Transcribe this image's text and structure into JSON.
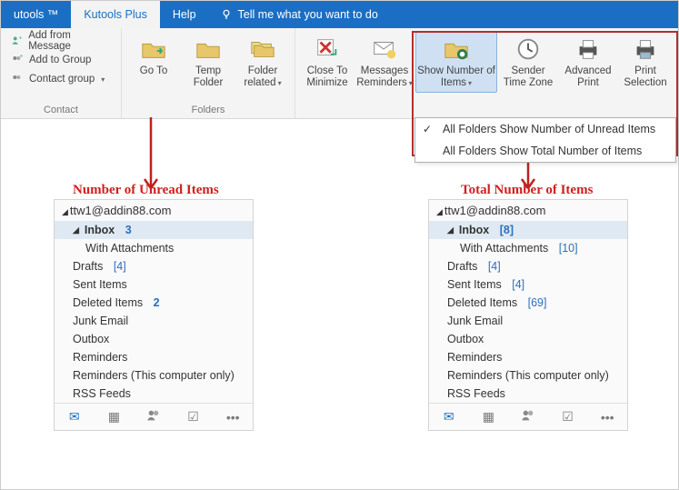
{
  "tabs": {
    "utools": "utools ™",
    "kutools_plus": "Kutools Plus",
    "help": "Help",
    "tellme": "Tell me what you want to do"
  },
  "ribbon": {
    "contact": {
      "label": "Contact",
      "add_from_message": "Add from Message",
      "add_to_group": "Add to Group",
      "contact_group": "Contact group"
    },
    "folders": {
      "label": "Folders",
      "goto": "Go To",
      "temp_folder": "Temp Folder",
      "folder_related": "Folder related"
    },
    "view": {
      "close_to_minimize": "Close To Minimize",
      "messages_reminders": "Messages Reminders",
      "show_number": "Show Number of Items",
      "sender_tz": "Sender Time Zone",
      "adv_print": "Advanced Print",
      "print_sel": "Print Selection"
    }
  },
  "dropdown": {
    "opt1": "All Folders Show Number of Unread Items",
    "opt2": "All Folders Show Total Number of Items"
  },
  "labels": {
    "unread": "Number of Unread Items",
    "total": "Total Number of Items"
  },
  "account": "ttw1@addin88.com",
  "panel_left": {
    "inbox": {
      "name": "Inbox",
      "count": "3"
    },
    "with_attach": {
      "name": "With Attachments",
      "count": ""
    },
    "drafts": {
      "name": "Drafts",
      "count": "[4]"
    },
    "sent": {
      "name": "Sent Items",
      "count": ""
    },
    "deleted": {
      "name": "Deleted Items",
      "count": "2"
    },
    "junk": {
      "name": "Junk Email"
    },
    "outbox": {
      "name": "Outbox"
    },
    "reminders": {
      "name": "Reminders"
    },
    "reminders_local": {
      "name": "Reminders (This computer only)"
    },
    "rss": {
      "name": "RSS Feeds"
    }
  },
  "panel_right": {
    "inbox": {
      "name": "Inbox",
      "count": "[8]"
    },
    "with_attach": {
      "name": "With Attachments",
      "count": "[10]"
    },
    "drafts": {
      "name": "Drafts",
      "count": "[4]"
    },
    "sent": {
      "name": "Sent Items",
      "count": "[4]"
    },
    "deleted": {
      "name": "Deleted Items",
      "count": "[69]"
    },
    "junk": {
      "name": "Junk Email"
    },
    "outbox": {
      "name": "Outbox"
    },
    "reminders": {
      "name": "Reminders"
    },
    "reminders_local": {
      "name": "Reminders (This computer only)"
    },
    "rss": {
      "name": "RSS Feeds"
    }
  }
}
